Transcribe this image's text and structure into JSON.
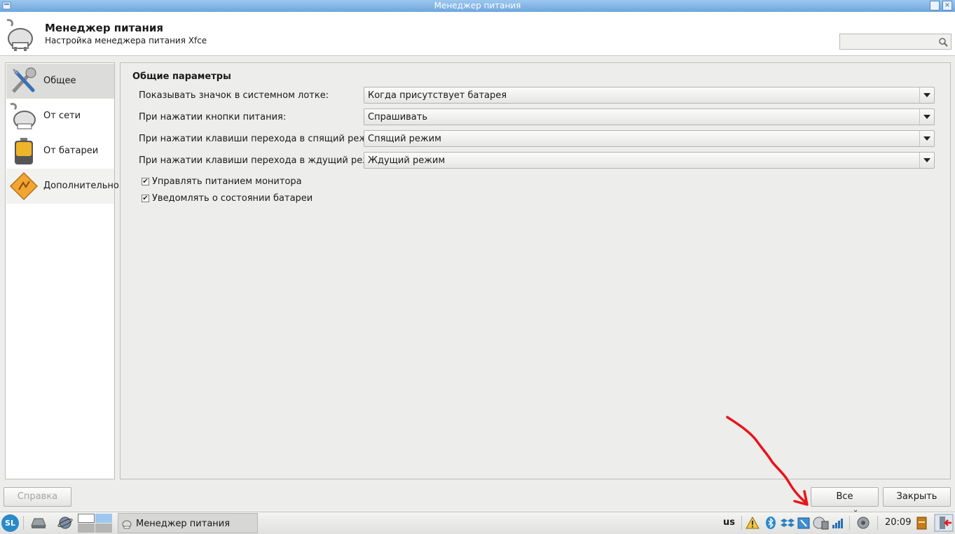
{
  "window": {
    "title": "Менеджер питания"
  },
  "header": {
    "title": "Менеджер питания",
    "subtitle": "Настройка менеджера питания Xfce"
  },
  "sidebar": {
    "items": [
      {
        "label": "Общее",
        "icon": "tools-icon",
        "active": true
      },
      {
        "label": "От сети",
        "icon": "plug-icon",
        "active": false
      },
      {
        "label": "От батареи",
        "icon": "battery-icon",
        "active": false
      },
      {
        "label": "Дополнительно",
        "icon": "advanced-icon",
        "active": false
      }
    ]
  },
  "general": {
    "section_title": "Общие параметры",
    "rows": [
      {
        "label": "Показывать значок в системном лотке:",
        "value": "Когда присутствует батарея"
      },
      {
        "label": "При нажатии кнопки питания:",
        "value": "Спрашивать"
      },
      {
        "label": "При нажатии клавиши перехода в спящий режим:",
        "value": "Спящий режим"
      },
      {
        "label": "При нажатии клавиши перехода в ждущий режим:",
        "value": "Ждущий режим"
      }
    ],
    "checkboxes": [
      {
        "label": "Управлять питанием монитора",
        "checked": true,
        "mark": "✔"
      },
      {
        "label": "Уведомлять о состоянии батареи",
        "checked": true,
        "mark": "✔"
      }
    ]
  },
  "buttons": {
    "help": "Справка",
    "all_settings": "Все настройки",
    "close": "Закрыть"
  },
  "taskbar": {
    "start": "SL",
    "task_label": "Менеджер питания",
    "keyboard_layout": "us",
    "clock": "20:09"
  },
  "colors": {
    "titlebar": "#7fb2e3",
    "annotation_arrow": "#e8141b"
  }
}
